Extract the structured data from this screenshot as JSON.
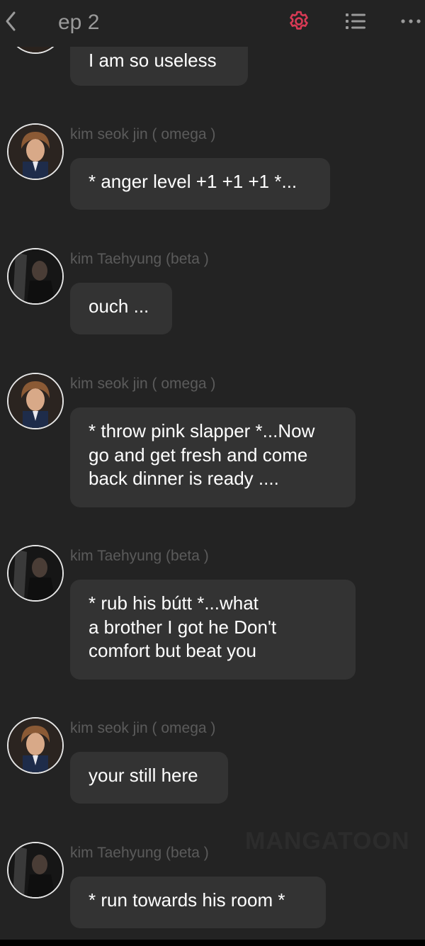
{
  "header": {
    "title": "ep 2",
    "back_icon": "chevron-left-icon",
    "settings_icon": "gear-icon",
    "list_icon": "list-icon",
    "more_icon": "more-horizontal-icon",
    "accent_color": "#d93a55"
  },
  "messages": [
    {
      "name": "",
      "text": "I am so useless"
    },
    {
      "name": "kim seok jin ( omega )",
      "text": "* anger level +1 +1 +1 *..."
    },
    {
      "name": "kim Taehyung (beta )",
      "text": "ouch ..."
    },
    {
      "name": "kim seok jin ( omega )",
      "text_lines": [
        "* throw pink slapper *...Now",
        "go and get fresh and come",
        "back dinner is ready ...."
      ]
    },
    {
      "name": "kim Taehyung (beta )",
      "text_lines": [
        "* rub his bútt *...what",
        "a brother I got he Don't",
        "comfort but beat you"
      ]
    },
    {
      "name": "kim seok jin ( omega )",
      "text": "your still here"
    },
    {
      "name": "kim Taehyung (beta )",
      "text": "* run towards his room *"
    }
  ],
  "watermark": "MANGATOON"
}
